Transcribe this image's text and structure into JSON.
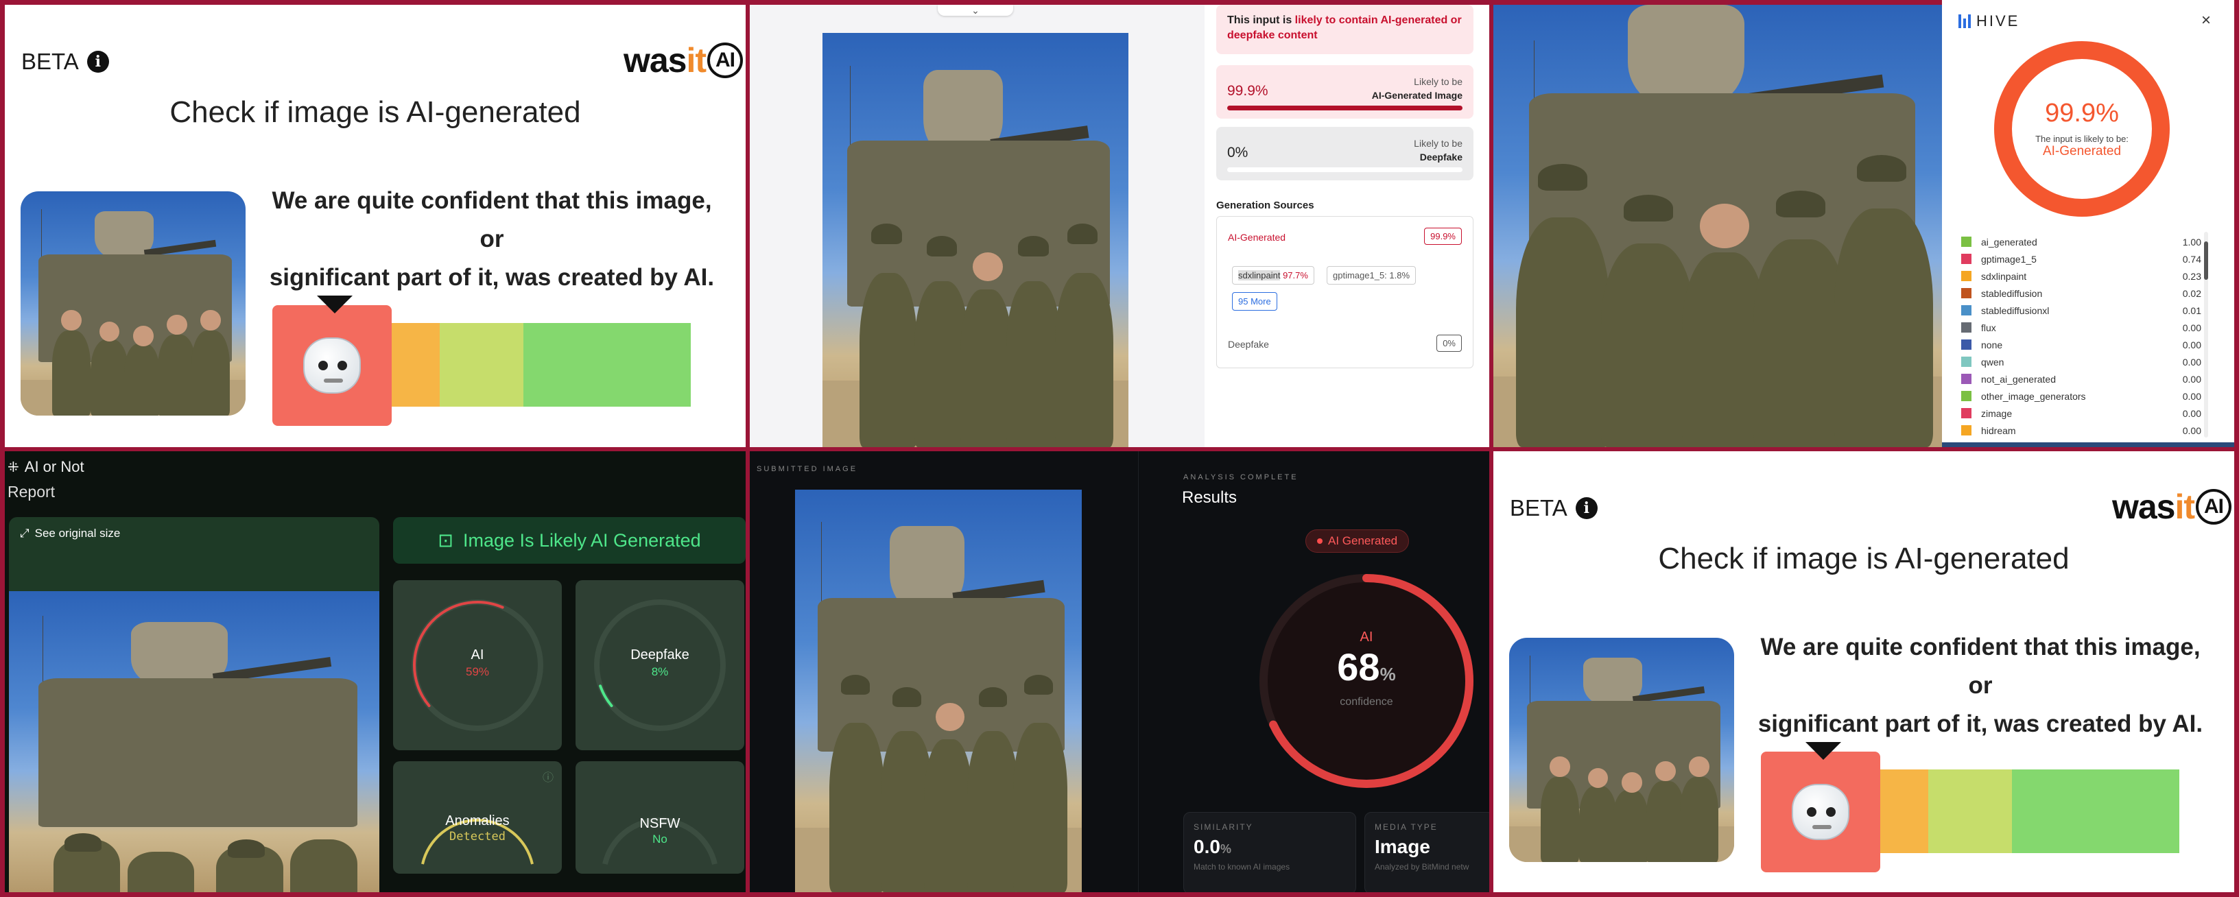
{
  "wasitai": {
    "beta_label": "BETA",
    "logo_was": "was",
    "logo_it": "it",
    "logo_ai": "AI",
    "title": "Check if image is AI-generated",
    "verdict_line1": "We are quite confident that this image, or",
    "verdict_line2": "significant part of it, was created by AI.",
    "meter_colors": [
      "#f36b5e",
      "#f58d45",
      "#f6b546",
      "#c6dd6b",
      "#84d86e"
    ]
  },
  "detector2": {
    "warning_prefix": "This input is ",
    "warning_red": "likely to contain AI-generated or deepfake content",
    "results": [
      {
        "pct": "99.9%",
        "likely": "Likely to be",
        "label": "AI-Generated Image",
        "fill": 0.999
      },
      {
        "pct": "0%",
        "likely": "Likely to be",
        "label": "Deepfake",
        "fill": 0.0
      }
    ],
    "gen_sources_title": "Generation Sources",
    "ai_generated_label": "AI-Generated",
    "ai_generated_value": "99.9%",
    "chips": [
      {
        "name": "sdxlinpaint",
        "value": "97.7%"
      },
      {
        "name": "gptimage1_5",
        "value": "1.8%"
      }
    ],
    "more_label": "95 More",
    "deepfake_label": "Deepfake",
    "deepfake_value": "0%",
    "accent": "#c8102e"
  },
  "hive": {
    "logo": "HIVE",
    "close": "×",
    "score": "99.9%",
    "likely": "The input is likely to be:",
    "class": "AI-Generated",
    "accent": "#f4572f",
    "classes": [
      {
        "name": "ai_generated",
        "value": "1.00",
        "color": "#7bc043"
      },
      {
        "name": "gptimage1_5",
        "value": "0.74",
        "color": "#e03c5f"
      },
      {
        "name": "sdxlinpaint",
        "value": "0.23",
        "color": "#f5a623"
      },
      {
        "name": "stablediffusion",
        "value": "0.02",
        "color": "#c0541e"
      },
      {
        "name": "stablediffusionxl",
        "value": "0.01",
        "color": "#4a90c8"
      },
      {
        "name": "flux",
        "value": "0.00",
        "color": "#666b73"
      },
      {
        "name": "none",
        "value": "0.00",
        "color": "#3c5aa8"
      },
      {
        "name": "qwen",
        "value": "0.00",
        "color": "#7fc7c0"
      },
      {
        "name": "not_ai_generated",
        "value": "0.00",
        "color": "#9b59b6"
      },
      {
        "name": "other_image_generators",
        "value": "0.00",
        "color": "#7bc043"
      },
      {
        "name": "zimage",
        "value": "0.00",
        "color": "#e03c5f"
      },
      {
        "name": "hidream",
        "value": "0.00",
        "color": "#f5a623"
      }
    ]
  },
  "aiornot": {
    "brand": "AI or Not",
    "report": "Report",
    "see_original": "See original size",
    "verdict": "Image Is Likely AI Generated",
    "gauges": [
      {
        "title": "AI",
        "value": "59%",
        "color": "#e04545",
        "fill": 0.59
      },
      {
        "title": "Deepfake",
        "value": "8%",
        "color": "#4ee68a",
        "fill": 0.08
      },
      {
        "title": "Anomalies",
        "value": "Detected",
        "color": "#d8c85a",
        "fill": 1.0
      },
      {
        "title": "NSFW",
        "value": "No",
        "color": "#4ee68a",
        "fill": 0.0
      }
    ]
  },
  "bitmind": {
    "submitted": "SUBMITTED IMAGE",
    "analysis": "ANALYSIS COMPLETE",
    "results": "Results",
    "pill": "AI Generated",
    "ai_label": "AI",
    "confidence_value": "68",
    "confidence_unit": "%",
    "confidence_label": "confidence",
    "confidence_fraction": 0.68,
    "similarity_caption": "SIMILARITY",
    "similarity_value": "0.0",
    "similarity_unit": "%",
    "similarity_sub": "Match to known AI images",
    "media_caption": "MEDIA TYPE",
    "media_value": "Image",
    "media_sub": "Analyzed by BitMind netw"
  }
}
